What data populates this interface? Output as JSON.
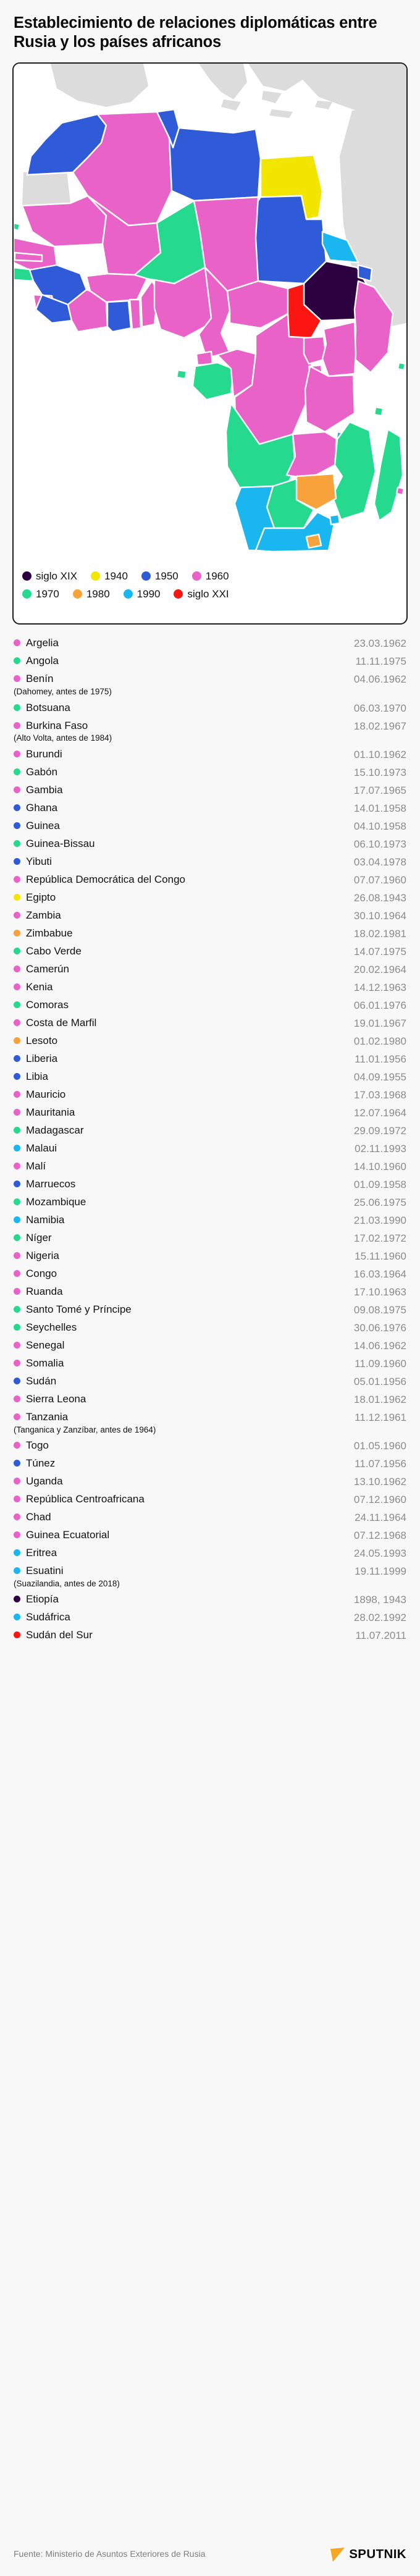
{
  "title": "Establecimiento de relaciones diplomáticas entre Rusia y los países africanos",
  "palette": {
    "siglo_xix": "#2d0140",
    "y1940": "#f2e500",
    "y1950": "#2f5bd8",
    "y1960": "#e862c8",
    "y1970": "#25da8f",
    "y1980": "#f8a23c",
    "y1990": "#1ab6f0",
    "siglo_xxi": "#fc1612",
    "no_data": "#d9d9d9",
    "map_bg": "#ffffff",
    "border": "#1d1d1d",
    "date_text": "#8b8b8b"
  },
  "legend": {
    "rows": [
      [
        {
          "label": "siglo XIX",
          "color": "#2d0140",
          "key": "siglo_xix"
        },
        {
          "label": "1940",
          "color": "#f2e500",
          "key": "y1940"
        },
        {
          "label": "1950",
          "color": "#2f5bd8",
          "key": "y1950"
        },
        {
          "label": "1960",
          "color": "#e862c8",
          "key": "y1960"
        }
      ],
      [
        {
          "label": "1970",
          "color": "#25da8f",
          "key": "y1970"
        },
        {
          "label": "1980",
          "color": "#f8a23c",
          "key": "y1980"
        },
        {
          "label": "1990",
          "color": "#1ab6f0",
          "key": "y1990"
        },
        {
          "label": "siglo XXI",
          "color": "#fc1612",
          "key": "siglo_xxi"
        }
      ]
    ]
  },
  "countries": [
    {
      "name": "Argelia",
      "alias": "",
      "date": "23.03.1962",
      "color": "#e862c8"
    },
    {
      "name": "Angola",
      "alias": "",
      "date": "11.11.1975",
      "color": "#25da8f"
    },
    {
      "name": "Benín",
      "alias": "(Dahomey, antes de 1975)",
      "date": "04.06.1962",
      "color": "#e862c8"
    },
    {
      "name": "Botsuana",
      "alias": "",
      "date": "06.03.1970",
      "color": "#25da8f"
    },
    {
      "name": "Burkina Faso",
      "alias": "(Alto Volta, antes de 1984)",
      "date": "18.02.1967",
      "color": "#e862c8"
    },
    {
      "name": "Burundi",
      "alias": "",
      "date": "01.10.1962",
      "color": "#e862c8"
    },
    {
      "name": "Gabón",
      "alias": "",
      "date": "15.10.1973",
      "color": "#25da8f"
    },
    {
      "name": "Gambia",
      "alias": "",
      "date": "17.07.1965",
      "color": "#e862c8"
    },
    {
      "name": "Ghana",
      "alias": "",
      "date": "14.01.1958",
      "color": "#2f5bd8"
    },
    {
      "name": "Guinea",
      "alias": "",
      "date": "04.10.1958",
      "color": "#2f5bd8"
    },
    {
      "name": "Guinea-Bissau",
      "alias": "",
      "date": "06.10.1973",
      "color": "#25da8f"
    },
    {
      "name": "Yibuti",
      "alias": "",
      "date": "03.04.1978",
      "color": "#2f5bd8"
    },
    {
      "name": "República Democrática del Congo",
      "alias": "",
      "date": "07.07.1960",
      "color": "#e862c8"
    },
    {
      "name": "Egipto",
      "alias": "",
      "date": "26.08.1943",
      "color": "#f2e500"
    },
    {
      "name": "Zambia",
      "alias": "",
      "date": "30.10.1964",
      "color": "#e862c8"
    },
    {
      "name": "Zimbabue",
      "alias": "",
      "date": "18.02.1981",
      "color": "#f8a23c"
    },
    {
      "name": "Cabo Verde",
      "alias": "",
      "date": "14.07.1975",
      "color": "#25da8f"
    },
    {
      "name": "Camerún",
      "alias": "",
      "date": "20.02.1964",
      "color": "#e862c8"
    },
    {
      "name": "Kenia",
      "alias": "",
      "date": "14.12.1963",
      "color": "#e862c8"
    },
    {
      "name": "Comoras",
      "alias": "",
      "date": "06.01.1976",
      "color": "#25da8f"
    },
    {
      "name": "Costa de Marfil",
      "alias": "",
      "date": "19.01.1967",
      "color": "#e862c8"
    },
    {
      "name": "Lesoto",
      "alias": "",
      "date": "01.02.1980",
      "color": "#f8a23c"
    },
    {
      "name": "Liberia",
      "alias": "",
      "date": "11.01.1956",
      "color": "#2f5bd8"
    },
    {
      "name": "Libia",
      "alias": "",
      "date": "04.09.1955",
      "color": "#2f5bd8"
    },
    {
      "name": "Mauricio",
      "alias": "",
      "date": "17.03.1968",
      "color": "#e862c8"
    },
    {
      "name": "Mauritania",
      "alias": "",
      "date": "12.07.1964",
      "color": "#e862c8"
    },
    {
      "name": "Madagascar",
      "alias": "",
      "date": "29.09.1972",
      "color": "#25da8f"
    },
    {
      "name": "Malaui",
      "alias": "",
      "date": "02.11.1993",
      "color": "#1ab6f0"
    },
    {
      "name": "Malí",
      "alias": "",
      "date": "14.10.1960",
      "color": "#e862c8"
    },
    {
      "name": "Marruecos",
      "alias": "",
      "date": "01.09.1958",
      "color": "#2f5bd8"
    },
    {
      "name": "Mozambique",
      "alias": "",
      "date": "25.06.1975",
      "color": "#25da8f"
    },
    {
      "name": "Namibia",
      "alias": "",
      "date": "21.03.1990",
      "color": "#1ab6f0"
    },
    {
      "name": "Níger",
      "alias": "",
      "date": "17.02.1972",
      "color": "#25da8f"
    },
    {
      "name": "Nigeria",
      "alias": "",
      "date": "15.11.1960",
      "color": "#e862c8"
    },
    {
      "name": "Congo",
      "alias": "",
      "date": "16.03.1964",
      "color": "#e862c8"
    },
    {
      "name": "Ruanda",
      "alias": "",
      "date": "17.10.1963",
      "color": "#e862c8"
    },
    {
      "name": "Santo Tomé y Príncipe",
      "alias": "",
      "date": "09.08.1975",
      "color": "#25da8f"
    },
    {
      "name": "Seychelles",
      "alias": "",
      "date": "30.06.1976",
      "color": "#25da8f"
    },
    {
      "name": "Senegal",
      "alias": "",
      "date": "14.06.1962",
      "color": "#e862c8"
    },
    {
      "name": "Somalia",
      "alias": "",
      "date": "11.09.1960",
      "color": "#e862c8"
    },
    {
      "name": "Sudán",
      "alias": "",
      "date": "05.01.1956",
      "color": "#2f5bd8"
    },
    {
      "name": "Sierra Leona",
      "alias": "",
      "date": "18.01.1962",
      "color": "#e862c8"
    },
    {
      "name": "Tanzania",
      "alias": "(Tanganica y Zanzíbar, antes de 1964)",
      "date": "11.12.1961",
      "color": "#e862c8"
    },
    {
      "name": "Togo",
      "alias": "",
      "date": "01.05.1960",
      "color": "#e862c8"
    },
    {
      "name": "Túnez",
      "alias": "",
      "date": "11.07.1956",
      "color": "#2f5bd8"
    },
    {
      "name": "Uganda",
      "alias": "",
      "date": "13.10.1962",
      "color": "#e862c8"
    },
    {
      "name": "República Centroafricana",
      "alias": "",
      "date": "07.12.1960",
      "color": "#e862c8"
    },
    {
      "name": "Chad",
      "alias": "",
      "date": "24.11.1964",
      "color": "#e862c8"
    },
    {
      "name": "Guinea Ecuatorial",
      "alias": "",
      "date": "07.12.1968",
      "color": "#e862c8"
    },
    {
      "name": "Eritrea",
      "alias": "",
      "date": "24.05.1993",
      "color": "#1ab6f0"
    },
    {
      "name": "Esuatini",
      "alias": "(Suazilandia, antes de 2018)",
      "date": "19.11.1999",
      "color": "#1ab6f0"
    },
    {
      "name": "Etiopía",
      "alias": "",
      "date": "1898, 1943",
      "color": "#2d0140"
    },
    {
      "name": "Sudáfrica",
      "alias": "",
      "date": "28.02.1992",
      "color": "#1ab6f0"
    },
    {
      "name": "Sudán del Sur",
      "alias": "",
      "date": "11.07.2011",
      "color": "#fc1612"
    }
  ],
  "footer": {
    "source": "Fuente: Ministerio de Asuntos Exteriores de Rusia",
    "brand": "SPUTNIK"
  }
}
